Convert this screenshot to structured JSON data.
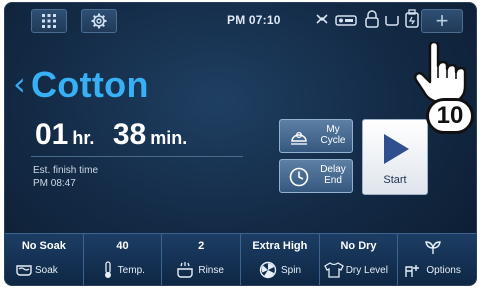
{
  "status_bar": {
    "apps_icon": "grid-icon",
    "settings_icon": "gear-icon",
    "time": "PM 07:10",
    "add_label": "+"
  },
  "cycle": {
    "name": "Cotton",
    "hours": "01",
    "hours_unit": "hr.",
    "minutes": "38",
    "minutes_unit": "min.",
    "est_label": "Est. finish time",
    "est_time": "PM 08:47"
  },
  "buttons": {
    "my_cycle": "My Cycle",
    "delay_end": "Delay End",
    "start": "Start"
  },
  "options": [
    {
      "value": "No Soak",
      "name": "Soak",
      "icon": "tub-icon"
    },
    {
      "value": "40",
      "name": "Temp.",
      "icon": "thermometer-icon"
    },
    {
      "value": "2",
      "name": "Rinse",
      "icon": "rinse-icon"
    },
    {
      "value": "Extra High",
      "name": "Spin",
      "icon": "spin-icon"
    },
    {
      "value": "No Dry",
      "name": "Dry Level",
      "icon": "shirt-icon"
    },
    {
      "value": "",
      "name": "Options",
      "icon": "options-icon"
    }
  ],
  "step_badge": "10",
  "colors": {
    "accent": "#38b0f5",
    "screen_bg": "#142c48"
  }
}
